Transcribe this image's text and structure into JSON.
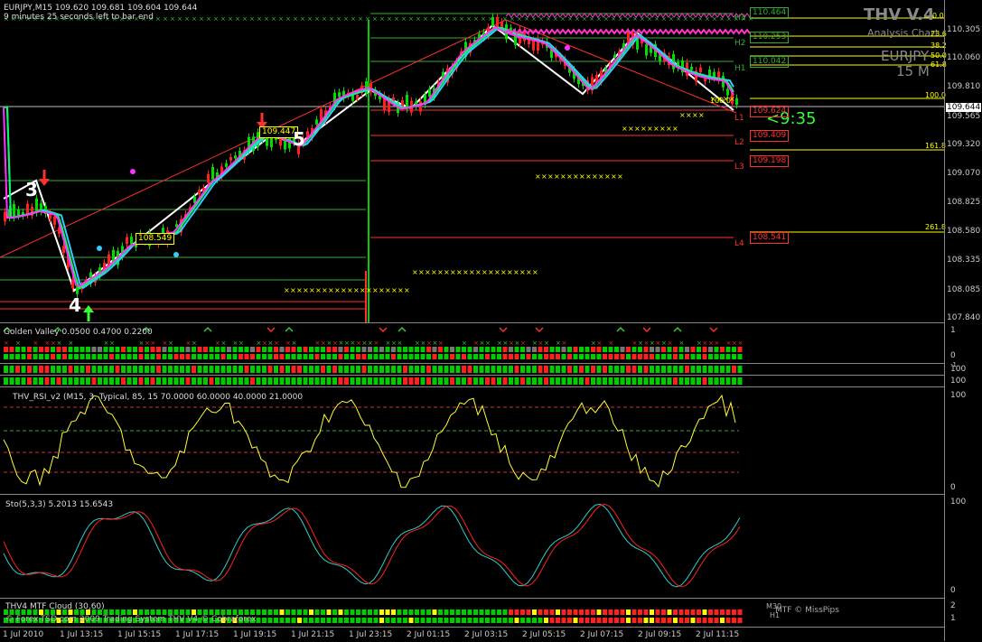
{
  "header": {
    "symbol_line": "EURJPY,M15  109.620 109.681 109.604 109.644",
    "countdown_line": "9 minutes 25 seconds left to bar end"
  },
  "watermark": {
    "title": "THV V.4",
    "subtitle": "Analysis Chart",
    "symbol": "EURJPY",
    "timeframe": "15 M"
  },
  "timer": "<9:35",
  "price_axis": [
    "110.305",
    "110.060",
    "109.810",
    "109.565",
    "109.320",
    "109.070",
    "108.825",
    "108.580",
    "108.335",
    "108.085",
    "107.840"
  ],
  "current_price": "109.644",
  "fib_levels": [
    "23.6",
    "38.2",
    "50.0",
    "61.8",
    "100.0",
    "100.0",
    "161.8",
    "261.8"
  ],
  "fib_top": "0.0",
  "pivot_labels": {
    "h3": "H3",
    "h2": "H2",
    "h1": "H1",
    "l1": "L1",
    "l2": "L2",
    "l3": "L3",
    "l4": "L4"
  },
  "pivot_values": {
    "h3": "110.464",
    "h2": "110.253",
    "h1": "110.042",
    "l1": "109.624",
    "l2": "109.409",
    "l3": "109.198",
    "l4": "108.541"
  },
  "price_tags": [
    "109.447",
    "108.549"
  ],
  "wave_labels": [
    "3",
    "4",
    "5"
  ],
  "indicators": {
    "golden_valley": "Golden Valley 0.0500 0.4700 0.2200",
    "rsi": "THV_RSI_v2  (M15, 3, Typical, 85, 15 70.0000 60.0000 40.0000 21.0000",
    "sto": "Sto(5,3,3) 5.2013 15.6543",
    "mtf": "THV4 MTF Cloud (30,60)",
    "copyright": "© Forex-TSD.com 2009 Trading System THV V4 © Cobraforex"
  },
  "pane_axis": {
    "gv": [
      "1",
      "0",
      "-1"
    ],
    "strip1": [
      "100"
    ],
    "strip2": [
      "100"
    ],
    "rsi": [
      "100",
      "0"
    ],
    "sto": [
      "100",
      "0"
    ],
    "mtf": [
      "2",
      "1"
    ]
  },
  "mtf_labels": {
    "m30": "M30",
    "h1": "H1",
    "credit": "MTF © MissPips"
  },
  "time_axis": [
    "1 Jul 2010",
    "1 Jul 13:15",
    "1 Jul 15:15",
    "1 Jul 17:15",
    "1 Jul 19:15",
    "1 Jul 21:15",
    "1 Jul 23:15",
    "2 Jul 01:15",
    "2 Jul 03:15",
    "2 Jul 05:15",
    "2 Jul 07:15",
    "2 Jul 09:15",
    "2 Jul 11:15"
  ],
  "colors": {
    "bull": "#00dd00",
    "bear": "#ff2020",
    "fib": "#ffff00",
    "pivot_red": "#ff3030",
    "pivot_green": "#33aa33",
    "ma_pink": "#ff33ff",
    "ma_blue": "#33ccff",
    "ma_green": "#00ff66",
    "zigzag": "#ffffff",
    "rsi": "#ffff33"
  }
}
